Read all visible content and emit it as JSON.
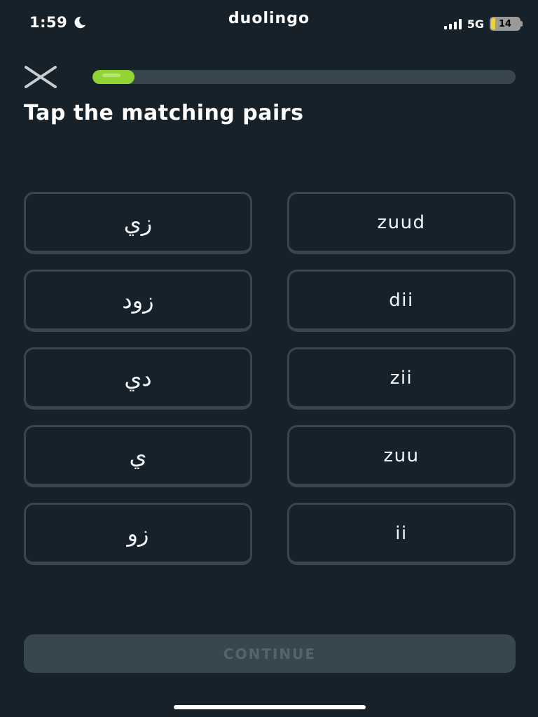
{
  "status_bar": {
    "time": "1:59",
    "icons": {
      "moon": "moon-icon",
      "signal": "cellular-signal-icon",
      "battery": "battery-icon"
    },
    "network": "5G",
    "battery_level": "14",
    "battery_fraction": 0.14,
    "battery_color": "#f2d230"
  },
  "app": {
    "brand": "duolingo"
  },
  "header": {
    "close_icon": "close-icon",
    "progress_fraction": 0.1,
    "progress_color": "#93d333"
  },
  "instruction": "Tap the matching pairs",
  "pairs": {
    "left": [
      "زي",
      "زود",
      "دي",
      "ي",
      "زو"
    ],
    "right": [
      "zuud",
      "dii",
      "zii",
      "zuu",
      "ii"
    ]
  },
  "continue_label": "CONTINUE",
  "colors": {
    "background": "#16212a",
    "tile_border": "#37464f",
    "button_disabled": "#37464f",
    "button_disabled_text": "#52656d"
  }
}
